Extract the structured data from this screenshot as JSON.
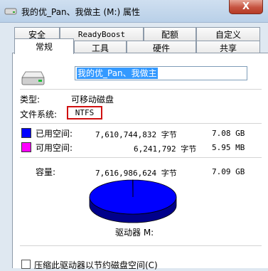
{
  "window": {
    "title": "我的优_Pan、我做主 (M:) 属性",
    "close_label": "X"
  },
  "tabs_back": [
    "安全",
    "ReadyBoost",
    "配额",
    "自定义"
  ],
  "tabs_front": [
    "常规",
    "工具",
    "硬件",
    "共享"
  ],
  "general": {
    "drive_name": "我的优_Pan、我做主",
    "type_label": "类型:",
    "type_value": "可移动磁盘",
    "fs_label": "文件系统:",
    "fs_value": "NTFS",
    "used_label": "已用空间:",
    "used_bytes": "7,610,744,832 字节",
    "used_size": "7.08 GB",
    "free_label": "可用空间:",
    "free_bytes": "6,241,792 字节",
    "free_size": "5.95 MB",
    "capacity_label": "容量:",
    "capacity_bytes": "7,616,986,624 字节",
    "capacity_size": "7.09 GB",
    "drive_label": "驱动器 M:",
    "compress_label": "压缩此驱动器以节约磁盘空间(C)"
  },
  "chart_data": {
    "type": "pie",
    "categories": [
      "已用空间",
      "可用空间"
    ],
    "values": [
      7610744832,
      6241792
    ],
    "colors": [
      "#0000ff",
      "#ff00ff"
    ]
  }
}
